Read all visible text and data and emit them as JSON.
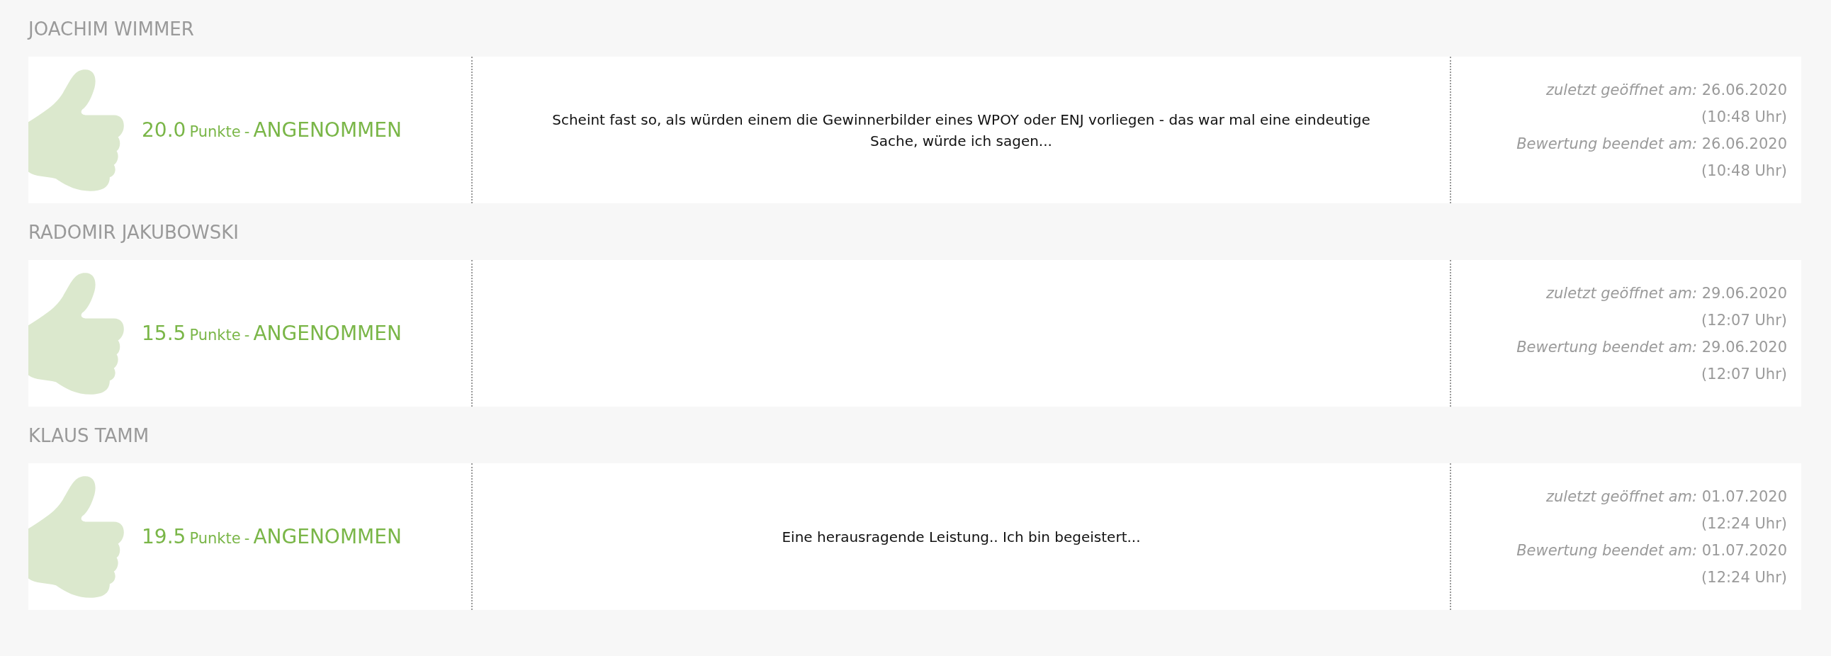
{
  "reviews": [
    {
      "name": "JOACHIM WIMMER",
      "score": "20.0",
      "unit": "Punkte",
      "separator": "-",
      "status": "ANGENOMMEN",
      "comment": "Scheint fast so, als würden einem die Gewinnerbilder eines WPOY oder ENJ vorliegen - das war mal eine eindeutige Sache, würde ich sagen...",
      "opened": "*zuletzt geöffnet am:* 26.06.2020",
      "opened_time": "(10:48 Uhr)",
      "finished": "*Bewertung beendet am:* 26.06.2020",
      "finished_time": "(10:48 Uhr)"
    },
    {
      "name": "RADOMIR JAKUBOWSKI",
      "score": "15.5",
      "unit": "Punkte",
      "separator": "-",
      "status": "ANGENOMMEN",
      "opened": "*zuletzt geöffnet am:* 29.06.2020",
      "opened_time": "(12:07 Uhr)",
      "finished": "*Bewertung beendet am:* 29.06.2020",
      "finished_time": "(12:07 Uhr)"
    },
    {
      "name": "KLAUS TAMM",
      "score": "19.5",
      "unit": "Punkte",
      "separator": "-",
      "status": "ANGENOMMEN",
      "comment": "Eine herausragende Leistung.. Ich bin begeistert...",
      "opened": "*zuletzt geöffnet am:* 01.07.2020",
      "opened_time": "(12:24 Uhr)",
      "finished": "*Bewertung beendet am:* 01.07.2020",
      "finished_time": "(12:24 Uhr)"
    }
  ]
}
